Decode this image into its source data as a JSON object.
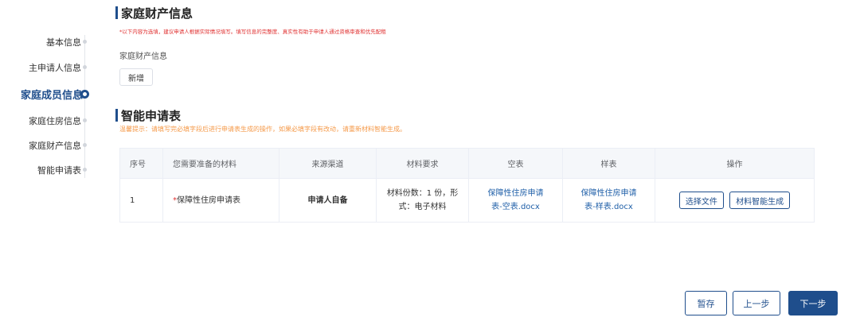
{
  "sidebar": {
    "steps": [
      {
        "label": "基本信息",
        "active": false
      },
      {
        "label": "主申请人信息",
        "active": false
      },
      {
        "label": "家庭成员信息",
        "active": true
      },
      {
        "label": "家庭住房信息",
        "active": false
      },
      {
        "label": "家庭财产信息",
        "active": false
      },
      {
        "label": "智能申请表",
        "active": false
      }
    ]
  },
  "property": {
    "title": "家庭财产信息",
    "notice": "*以下内容为选填，建议申请人根据实际情况填写。填写信息的完整度、真实性有助于申请人通过资格审查和优先配租",
    "field_label": "家庭财产信息",
    "add_label": "新增"
  },
  "form": {
    "title": "智能申请表",
    "notice": "温馨提示：请填写完必填字段后进行申请表生成的操作，如果必填字段有改动，请重新材料智能生成。",
    "columns": [
      "序号",
      "您需要准备的材料",
      "来源渠道",
      "材料要求",
      "空表",
      "样表",
      "操作"
    ],
    "rows": [
      {
        "index": "1",
        "required_mark": "*",
        "material": "保障性住房申请表",
        "source": "申请人自备",
        "req_line1": "材料份数：1 份，形",
        "req_line2": "式：电子材料",
        "blank_line1": "保障性住房申请",
        "blank_line2": "表-空表.docx",
        "sample_line1": "保障性住房申请",
        "sample_line2": "表-样表.docx",
        "btn_select": "选择文件",
        "btn_generate": "材料智能生成"
      }
    ]
  },
  "footer": {
    "save": "暂存",
    "prev": "上一步",
    "next": "下一步"
  }
}
